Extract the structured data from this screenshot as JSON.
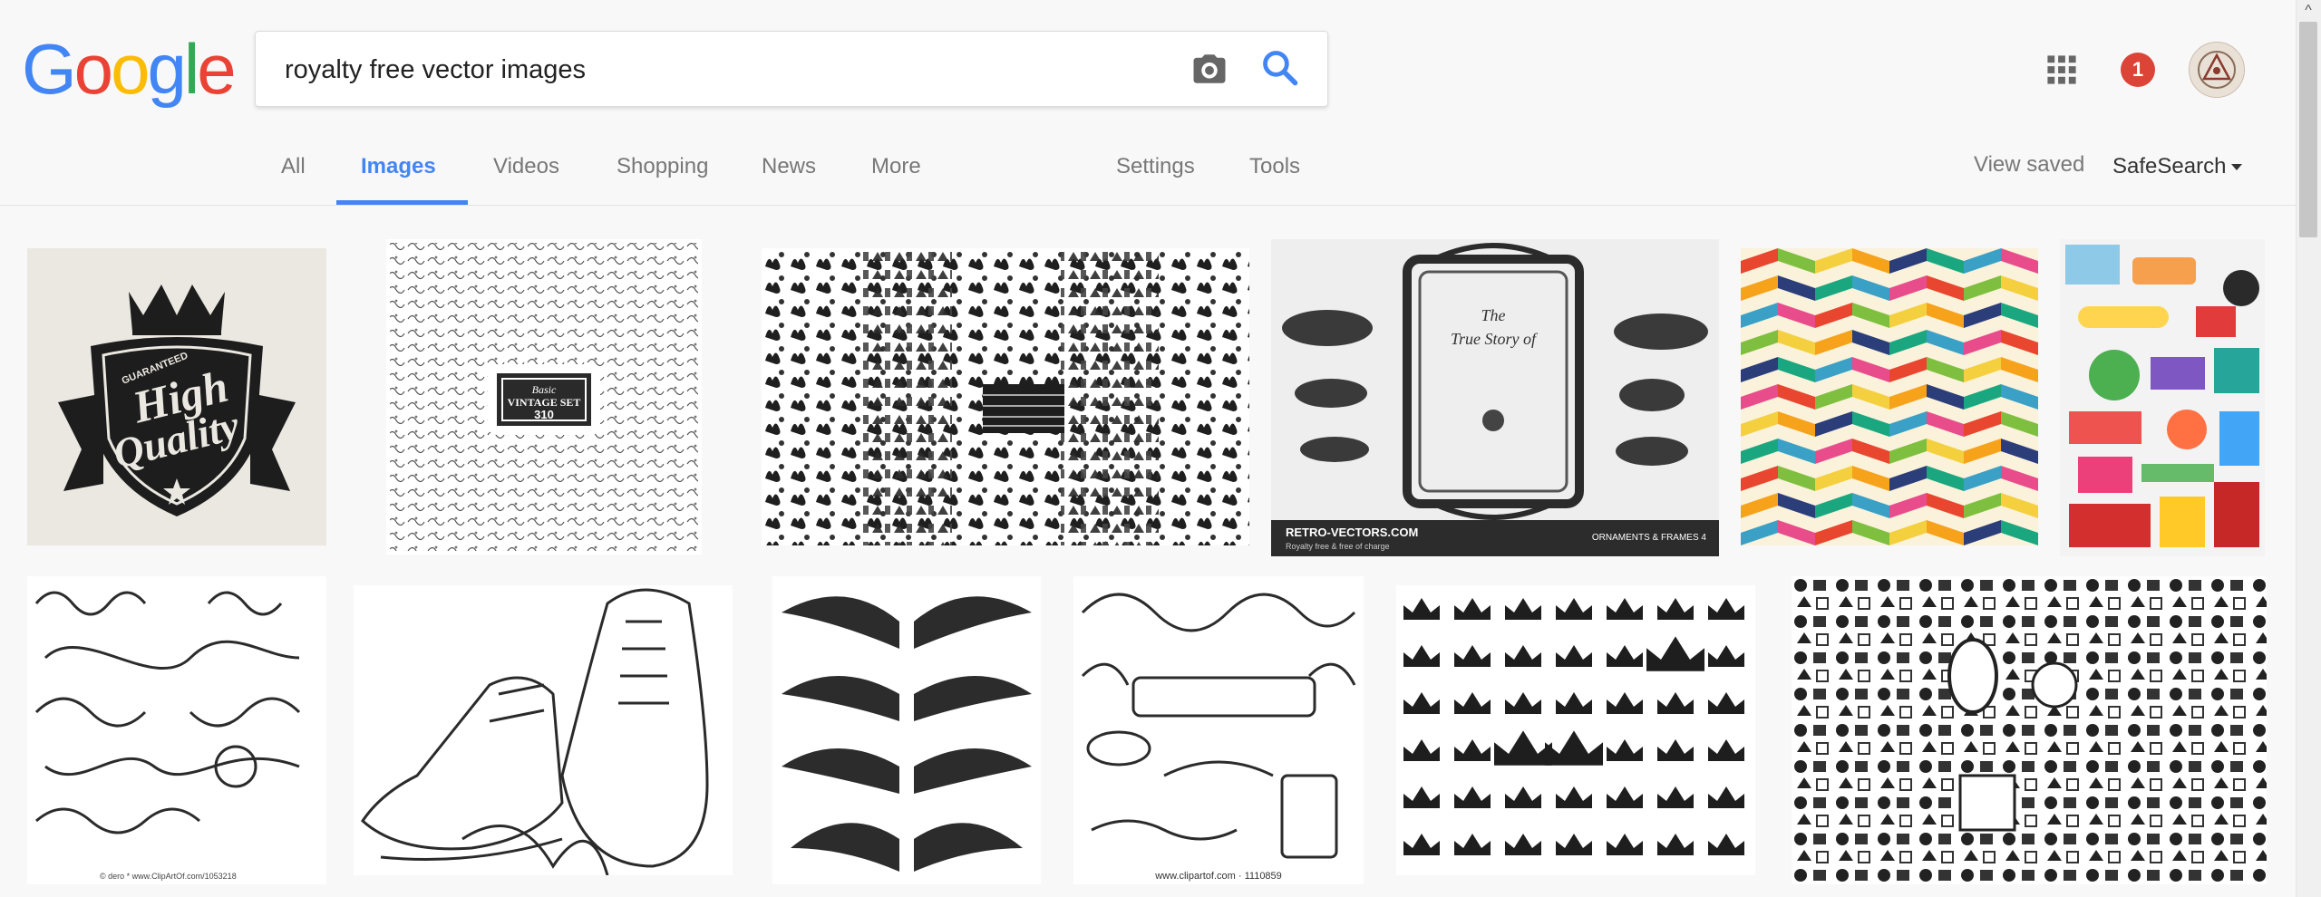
{
  "header": {
    "logo_text": "Google",
    "search": {
      "value": "royalty free vector images",
      "placeholder": ""
    },
    "notification_count": "1"
  },
  "tabs": {
    "items": [
      "All",
      "Images",
      "Videos",
      "Shopping",
      "News",
      "More"
    ],
    "active": "Images",
    "settings_label": "Settings",
    "tools_label": "Tools",
    "view_saved_label": "View saved",
    "safesearch_label": "SafeSearch"
  },
  "results": {
    "row1": [
      {
        "id": "high-quality-badge",
        "label_lines": [
          "GUARANTEED",
          "High",
          "Quality"
        ]
      },
      {
        "id": "vintage-set",
        "label_lines": [
          "Basic",
          "VINTAGE SET",
          "310"
        ]
      },
      {
        "id": "silhouettes-collage"
      },
      {
        "id": "retro-vectors-frame",
        "label_lines": [
          "The",
          "True Story of",
          "RETRO-VECTORS.COM",
          "Royalty free & free of charge",
          "ORNAMENTS & FRAMES 4"
        ]
      },
      {
        "id": "chevron-pattern"
      },
      {
        "id": "clipart-collage"
      }
    ],
    "row2": [
      {
        "id": "swirl-ornaments",
        "label_lines": [
          "© dero * www.ClipArtOf.com/1053218"
        ]
      },
      {
        "id": "sneakers-sketch"
      },
      {
        "id": "wings-set"
      },
      {
        "id": "scroll-frames",
        "label_lines": [
          "www.clipartof.com · 1110859"
        ]
      },
      {
        "id": "crowns-set"
      },
      {
        "id": "icons-silhouettes"
      }
    ]
  },
  "colors": {
    "google_blue": "#4285f4",
    "google_red": "#ea4335",
    "google_yellow": "#fbbc05",
    "google_green": "#34a853",
    "badge_red": "#db4437",
    "chevron": [
      "#e8462f",
      "#f7a21b",
      "#3aa0c6",
      "#7fbf3f",
      "#2c3e7a",
      "#e84c8b",
      "#f4d03f",
      "#1aa77f"
    ]
  }
}
